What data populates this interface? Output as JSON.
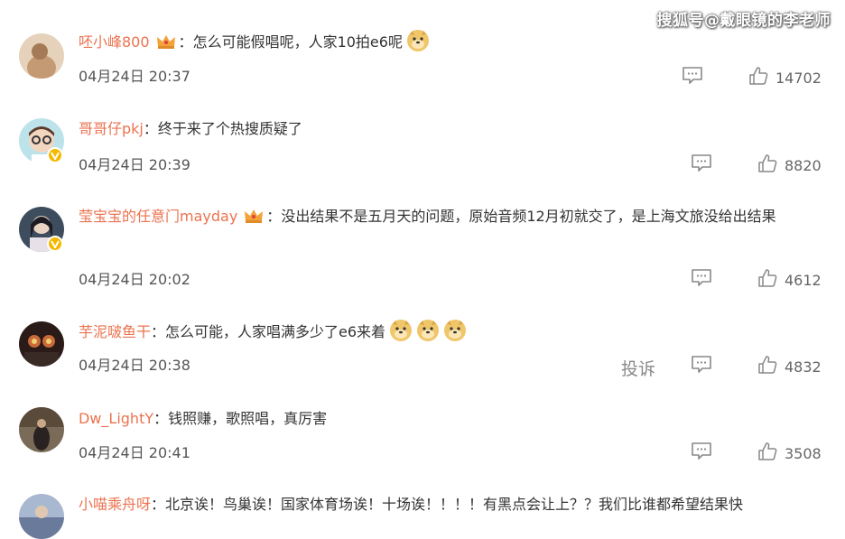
{
  "watermark": "搜狐号@戴眼镜的李老师",
  "separator": "：",
  "comments": [
    {
      "username": "呸小峰800",
      "text": "怎么可能假唱呢，人家10拍e6呢",
      "time": "04月24日 20:37",
      "likes": "14702",
      "crown": true,
      "emoji_count": 1,
      "verified": false,
      "avatar_color": "#d8b99a"
    },
    {
      "username": "哥哥仔pkj",
      "text": "终于来了个热搜质疑了",
      "time": "04月24日 20:39",
      "likes": "8820",
      "crown": false,
      "emoji_count": 0,
      "verified": true,
      "avatar_color": "#9ccfd8"
    },
    {
      "username": "莹宝宝的任意门mayday",
      "text": "没出结果不是五月天的问题，原始音频12月初就交了，是上海文旅没给出结果",
      "time": "04月24日 20:02",
      "likes": "4612",
      "crown": true,
      "emoji_count": 0,
      "verified": true,
      "avatar_color": "#3b4a5a"
    },
    {
      "username": "芋泥啵鱼干",
      "text": "怎么可能，人家唱满多少了e6来着",
      "time": "04月24日 20:38",
      "likes": "4832",
      "crown": false,
      "emoji_count": 3,
      "verified": false,
      "avatar_color": "#2a1a18",
      "report": "投诉"
    },
    {
      "username": "Dw_LightY",
      "text": "钱照赚，歌照唱，真厉害",
      "time": "04月24日 20:41",
      "likes": "3508",
      "crown": false,
      "emoji_count": 0,
      "verified": false,
      "avatar_color": "#6a5a48"
    },
    {
      "username": "小喵乘舟呀",
      "text": "北京诶！鸟巢诶！国家体育场诶！十场诶！！！！有黑点会让上？？我们比谁都希望结果快",
      "crown": false,
      "emoji_count": 0,
      "verified": false,
      "avatar_color": "#a8b8d0"
    }
  ],
  "colors": {
    "username": "#eb7350",
    "text": "#333333",
    "meta": "#555555",
    "badge": "#f5b800"
  },
  "icons": {
    "reply": "comment-icon",
    "like": "thumbs-up-icon",
    "crown": "crown-icon",
    "emoji": "doge-emoji-icon",
    "verified": "verified-badge-icon"
  }
}
